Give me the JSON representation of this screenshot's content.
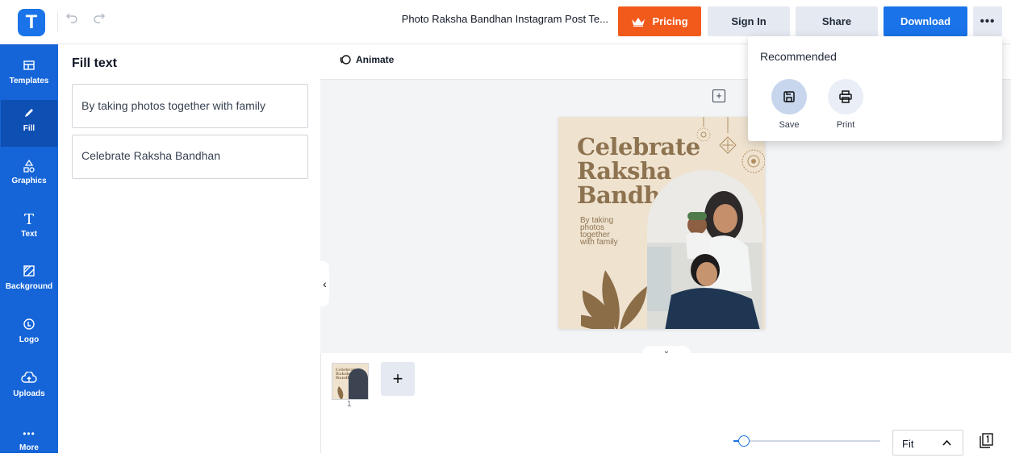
{
  "app": {
    "logo_letter": "T",
    "document_title": "Photo Raksha Bandhan Instagram Post Te..."
  },
  "toolbar": {
    "pricing_label": "Pricing",
    "signin_label": "Sign In",
    "share_label": "Share",
    "download_label": "Download",
    "more_label": "•••"
  },
  "sidebar": {
    "items": [
      {
        "label": "Templates",
        "icon": "templates-icon"
      },
      {
        "label": "Fill",
        "icon": "pencil-icon",
        "active": true
      },
      {
        "label": "Graphics",
        "icon": "shapes-icon"
      },
      {
        "label": "Text",
        "icon": "text-icon"
      },
      {
        "label": "Background",
        "icon": "background-icon"
      },
      {
        "label": "Logo",
        "icon": "logo-icon"
      },
      {
        "label": "Uploads",
        "icon": "upload-cloud-icon"
      },
      {
        "label": "More",
        "icon": "more-dots-icon"
      }
    ]
  },
  "panel": {
    "title": "Fill text",
    "fields": [
      "By taking photos together with family",
      "Celebrate Raksha Bandhan"
    ]
  },
  "canvas": {
    "animate_label": "Animate",
    "poster": {
      "headline_lines": [
        "Celebrate",
        "Raksha",
        "Bandhan"
      ],
      "subtext_lines": [
        "By taking",
        "photos",
        "together",
        "with family"
      ]
    }
  },
  "pages": {
    "thumb_lines": [
      "Celebrate",
      "Raksha",
      "Bandhan"
    ],
    "current_page": "1",
    "add_label": "+"
  },
  "zoom": {
    "mode": "Fit",
    "level_fraction": 0.04
  },
  "dropdown": {
    "title": "Recommended",
    "items": [
      {
        "label": "Save",
        "icon": "save-icon"
      },
      {
        "label": "Print",
        "icon": "print-icon"
      }
    ]
  },
  "colors": {
    "brand_blue": "#1a73e8",
    "sidebar_blue": "#1565d8",
    "pricing_orange": "#f25a1c",
    "poster_gold": "#8e7350",
    "poster_bg": "#efe3d0"
  }
}
